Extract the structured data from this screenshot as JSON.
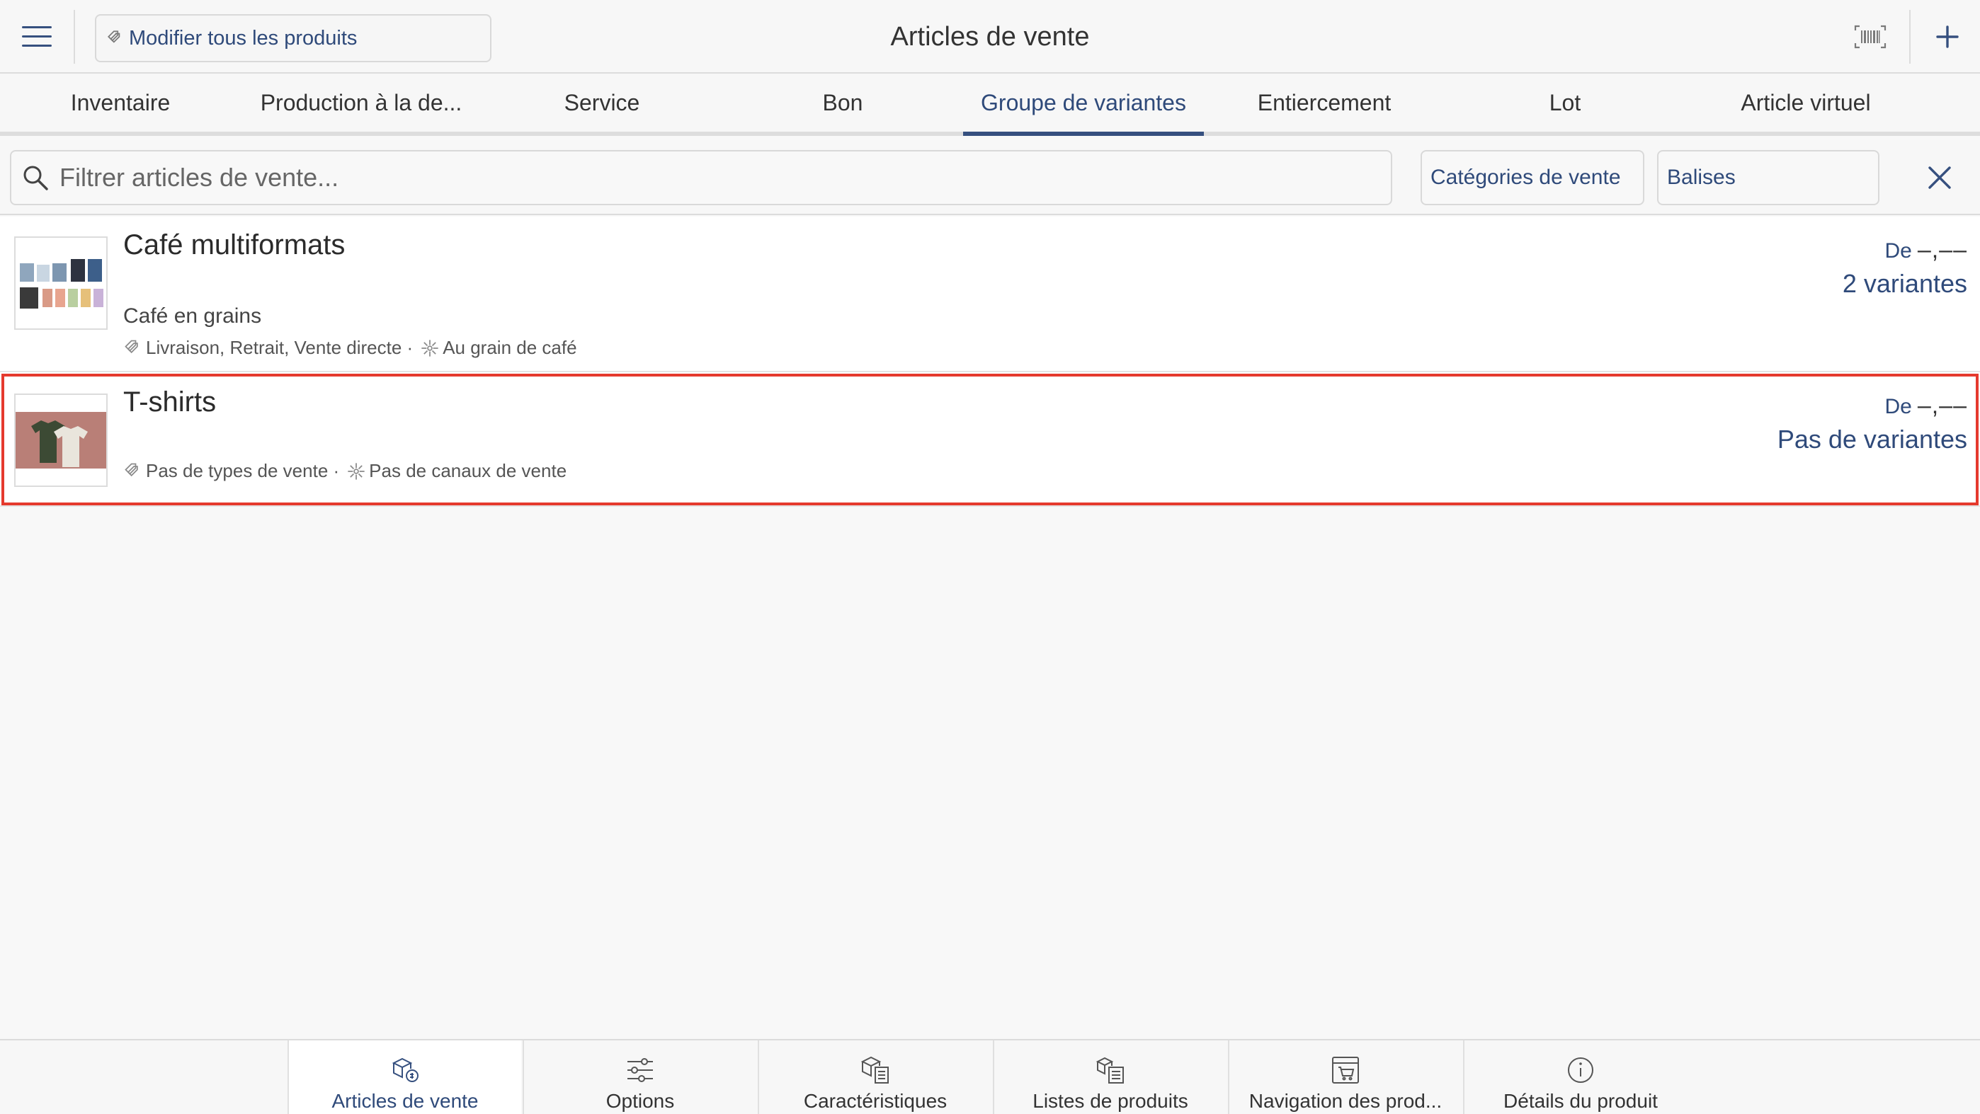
{
  "header": {
    "title": "Articles de vente",
    "edit_all_label": "Modifier tous les produits"
  },
  "tabs": [
    {
      "label": "Inventaire",
      "active": false
    },
    {
      "label": "Production à la de...",
      "active": false
    },
    {
      "label": "Service",
      "active": false
    },
    {
      "label": "Bon",
      "active": false
    },
    {
      "label": "Groupe de variantes",
      "active": true
    },
    {
      "label": "Entiercement",
      "active": false
    },
    {
      "label": "Lot",
      "active": false
    },
    {
      "label": "Article virtuel",
      "active": false
    }
  ],
  "filter": {
    "search_placeholder": "Filtrer articles de vente...",
    "categories_label": "Catégories de vente",
    "tags_label": "Balises"
  },
  "items": [
    {
      "name": "Café multiformats",
      "subtitle": "Café en grains",
      "sale_types": "Livraison, Retrait, Vente directe ·",
      "channels": "Au grain de café",
      "price_prefix": "De",
      "price_value": "–,––",
      "variants": "2 variantes"
    },
    {
      "name": "T-shirts",
      "sale_types": "Pas de types de vente ·",
      "channels": "Pas de canaux de vente",
      "price_prefix": "De",
      "price_value": "–,––",
      "variants": "Pas de variantes",
      "selected": true
    }
  ],
  "bottom_nav": [
    {
      "label": "Articles de vente",
      "icon": "sale-items-icon",
      "active": true
    },
    {
      "label": "Options",
      "icon": "sliders-icon",
      "active": false
    },
    {
      "label": "Caractéristiques",
      "icon": "characteristics-icon",
      "active": false
    },
    {
      "label": "Listes de produits",
      "icon": "product-lists-icon",
      "active": false
    },
    {
      "label": "Navigation des prod...",
      "icon": "cart-navigation-icon",
      "active": false
    },
    {
      "label": "Détails du produit",
      "icon": "info-icon",
      "active": false
    }
  ],
  "colors": {
    "accent": "#36507f",
    "selection_outline": "#e53a2e",
    "background": "#f8f8f8"
  }
}
